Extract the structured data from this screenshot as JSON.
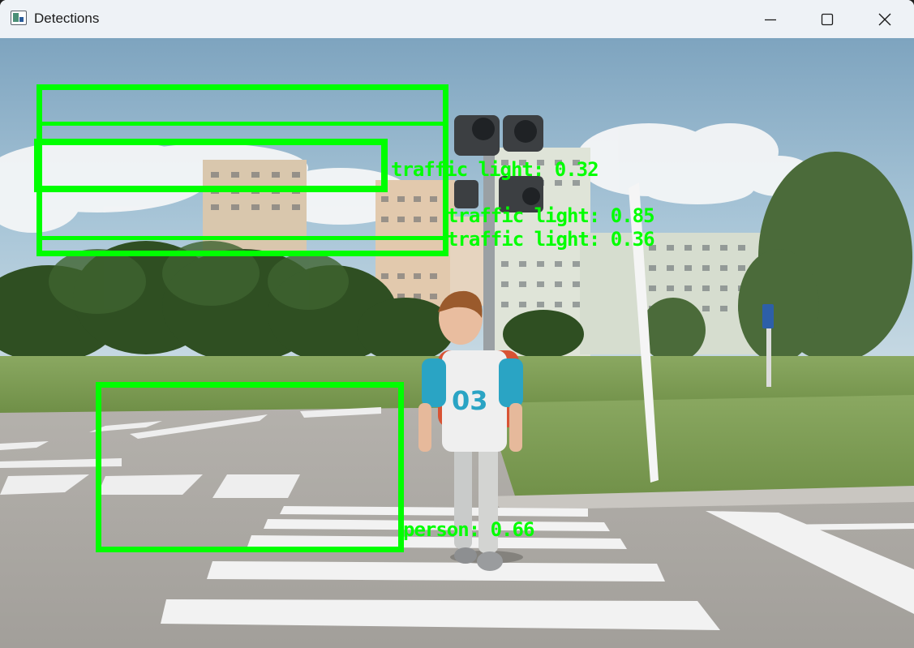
{
  "window": {
    "title": "Detections",
    "app_icon": "image-viewer-icon",
    "controls": {
      "minimize_icon": "minimize-icon",
      "maximize_icon": "maximize-icon",
      "close_icon": "close-icon"
    }
  },
  "detection_color": "#00ff00",
  "detections": [
    {
      "class": "traffic light",
      "score": "0.32",
      "label": "traffic light: 0.32"
    },
    {
      "class": "traffic light",
      "score": "0.85",
      "label": "traffic light: 0.85"
    },
    {
      "class": "traffic light",
      "score": "0.36",
      "label": "traffic light: 0.36"
    },
    {
      "class": "person",
      "score": "0.66",
      "label": "person: 0.66"
    }
  ]
}
